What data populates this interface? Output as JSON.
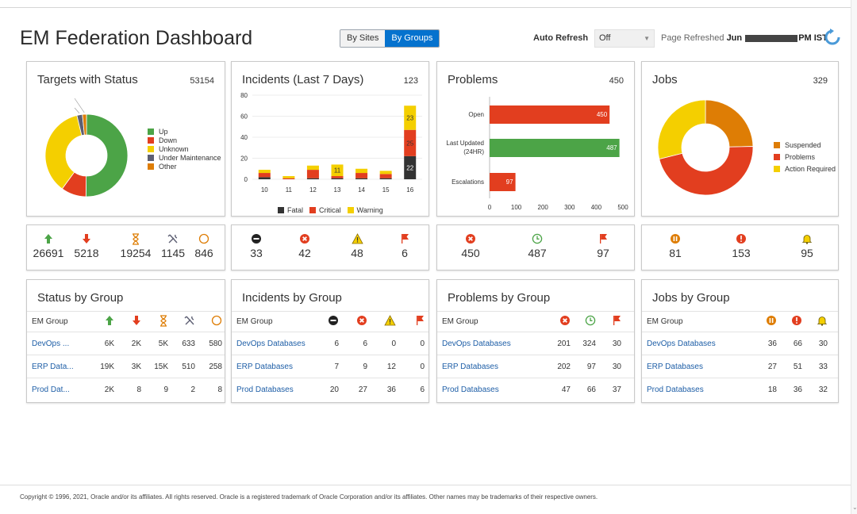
{
  "page": {
    "title": "EM Federation Dashboard",
    "view_toggle": {
      "by_sites": "By Sites",
      "by_groups": "By Groups"
    },
    "auto_refresh": {
      "label": "Auto Refresh",
      "value": "Off"
    },
    "refreshed": {
      "prefix": "Page Refreshed",
      "date_part": "Jun",
      "suffix": "PM IST"
    }
  },
  "colors": {
    "up": "#4ca447",
    "down": "#e23e1f",
    "unknown": "#f4cf00",
    "maintenance": "#5d5f73",
    "other": "#de7d05",
    "fatal": "#333333",
    "accent": "#0572ce",
    "link": "#1f5fa7"
  },
  "targets": {
    "title": "Targets with Status",
    "total": "53154",
    "chart_data": {
      "type": "pie",
      "labels": [
        "Up",
        "Down",
        "Unknown",
        "Under Maintenance",
        "Other"
      ],
      "values": [
        26691,
        5218,
        19254,
        1145,
        846
      ],
      "data_labels": [
        "26691",
        "5218",
        "19254",
        "1145",
        "846"
      ]
    },
    "legend": [
      "Up",
      "Down",
      "Unknown",
      "Under Maintenance",
      "Other"
    ],
    "stats": [
      {
        "icon": "arrow-up-icon",
        "value": "26691"
      },
      {
        "icon": "arrow-down-icon",
        "value": "5218"
      },
      {
        "icon": "hourglass-icon",
        "value": "19254"
      },
      {
        "icon": "wrench-icon",
        "value": "1145"
      },
      {
        "icon": "circle-icon",
        "value": "846"
      }
    ]
  },
  "incidents": {
    "title": "Incidents (Last 7 Days)",
    "total": "123",
    "chart_data": {
      "type": "bar",
      "categories": [
        "10",
        "11",
        "12",
        "13",
        "14",
        "15",
        "16"
      ],
      "series": [
        {
          "name": "Fatal",
          "values": [
            2,
            0,
            1,
            1,
            1,
            1,
            22
          ]
        },
        {
          "name": "Critical",
          "values": [
            4,
            1,
            8,
            2,
            5,
            4,
            25
          ]
        },
        {
          "name": "Warning",
          "values": [
            3,
            2,
            4,
            11,
            4,
            3,
            23
          ]
        }
      ],
      "bar_labels": {
        "13": {
          "Warning": "11"
        },
        "16": {
          "Fatal": "22",
          "Critical": "25",
          "Warning": "23"
        }
      },
      "yticks": [
        "0",
        "20",
        "40",
        "60",
        "80"
      ],
      "ylim": [
        0,
        80
      ]
    },
    "legend": [
      "Fatal",
      "Critical",
      "Warning"
    ],
    "stats": [
      {
        "icon": "fatal-icon",
        "value": "33"
      },
      {
        "icon": "critical-icon",
        "value": "42"
      },
      {
        "icon": "warning-icon",
        "value": "48"
      },
      {
        "icon": "flag-icon",
        "value": "6"
      }
    ]
  },
  "problems": {
    "title": "Problems",
    "total": "450",
    "chart_data": {
      "type": "bar",
      "orientation": "horizontal",
      "categories": [
        "Open",
        "Last Updated (24HR)",
        "Escalations"
      ],
      "category_lines": [
        [
          "Open"
        ],
        [
          "Last Updated",
          "(24HR)"
        ],
        [
          "Escalations"
        ]
      ],
      "values": [
        450,
        487,
        97
      ],
      "xticks": [
        "0",
        "100",
        "200",
        "300",
        "400",
        "500"
      ],
      "xlim": [
        0,
        500
      ]
    },
    "stats": [
      {
        "icon": "critical-icon",
        "value": "450"
      },
      {
        "icon": "clock-icon",
        "value": "487"
      },
      {
        "icon": "flag-icon",
        "value": "97"
      }
    ]
  },
  "jobs": {
    "title": "Jobs",
    "total": "329",
    "chart_data": {
      "type": "pie",
      "labels": [
        "Suspended",
        "Problems",
        "Action Required"
      ],
      "values": [
        81,
        153,
        95
      ],
      "data_labels": [
        "81",
        "153",
        "95"
      ]
    },
    "legend": [
      "Suspended",
      "Problems",
      "Action Required"
    ],
    "stats": [
      {
        "icon": "pause-icon",
        "value": "81"
      },
      {
        "icon": "problem-icon",
        "value": "153"
      },
      {
        "icon": "bell-icon",
        "value": "95"
      }
    ]
  },
  "status_by_group": {
    "title": "Status by Group",
    "header": "EM Group",
    "rows": [
      {
        "name": "DevOps ...",
        "values": [
          "6K",
          "2K",
          "5K",
          "633",
          "580"
        ]
      },
      {
        "name": "ERP Data...",
        "values": [
          "19K",
          "3K",
          "15K",
          "510",
          "258"
        ]
      },
      {
        "name": "Prod Dat...",
        "values": [
          "2K",
          "8",
          "9",
          "2",
          "8"
        ]
      }
    ]
  },
  "incidents_by_group": {
    "title": "Incidents by Group",
    "header": "EM Group",
    "rows": [
      {
        "name": "DevOps Databases",
        "values": [
          "6",
          "6",
          "0",
          "0"
        ]
      },
      {
        "name": "ERP Databases",
        "values": [
          "7",
          "9",
          "12",
          "0"
        ]
      },
      {
        "name": "Prod Databases",
        "values": [
          "20",
          "27",
          "36",
          "6"
        ]
      }
    ]
  },
  "problems_by_group": {
    "title": "Problems by Group",
    "header": "EM Group",
    "rows": [
      {
        "name": "DevOps Databases",
        "values": [
          "201",
          "324",
          "30"
        ]
      },
      {
        "name": "ERP Databases",
        "values": [
          "202",
          "97",
          "30"
        ]
      },
      {
        "name": "Prod Databases",
        "values": [
          "47",
          "66",
          "37"
        ]
      }
    ]
  },
  "jobs_by_group": {
    "title": "Jobs by Group",
    "header": "EM Group",
    "rows": [
      {
        "name": "DevOps Databases",
        "values": [
          "36",
          "66",
          "30"
        ]
      },
      {
        "name": "ERP Databases",
        "values": [
          "27",
          "51",
          "33"
        ]
      },
      {
        "name": "Prod Databases",
        "values": [
          "18",
          "36",
          "32"
        ]
      }
    ]
  },
  "footer": "Copyright © 1996, 2021, Oracle and/or its affiliates. All rights reserved. Oracle is a registered trademark of Oracle Corporation and/or its affiliates. Other names may be trademarks of their respective owners."
}
